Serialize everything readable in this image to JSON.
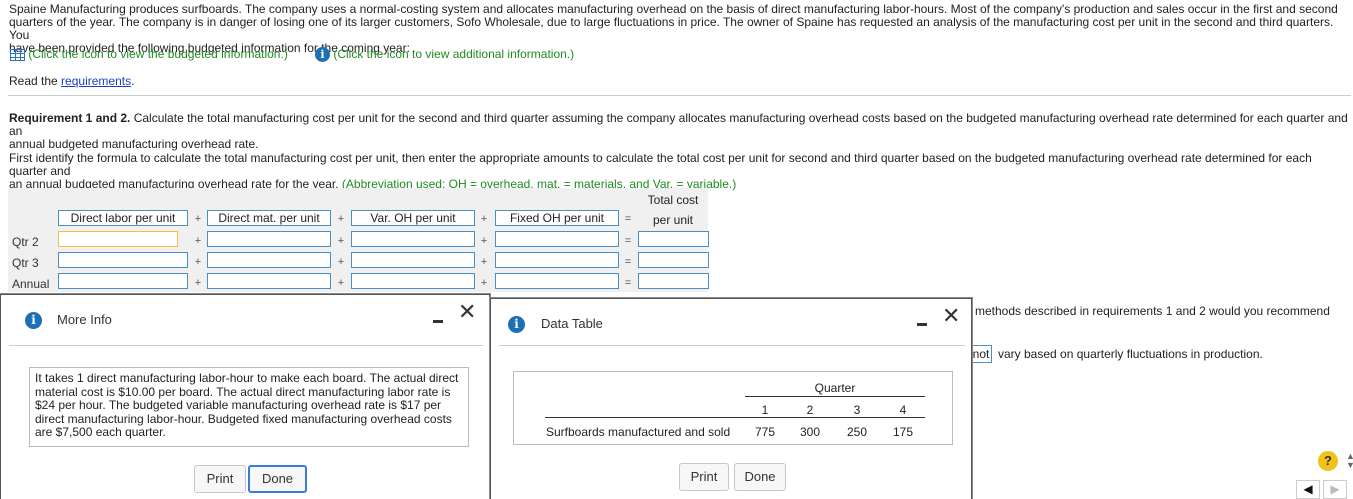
{
  "intro": {
    "line1": "Spaine Manufacturing produces surfboards. The company uses a normal-costing system and allocates manufacturing overhead on the basis of direct manufacturing labor-hours. Most of the company's production and sales occur in the first and second",
    "line2": "quarters of the year. The company is in danger of losing one of its larger customers, Sofo Wholesale, due to large fluctuations in price. The owner of Spaine has requested an analysis of the manufacturing cost per unit in the second and third quarters. You",
    "line3": "have been provided the following budgeted information for the coming year:",
    "budget_link": "(Click the icon to view the budgeted information.)",
    "additional_link": "(Click the icon to view additional information.)",
    "read_prefix": "Read the ",
    "requirements_link": "requirements",
    "read_suffix": "."
  },
  "requirement": {
    "label": "Requirement 1 and 2.",
    "text1": " Calculate the total manufacturing cost per unit for the second and third quarter assuming the company allocates manufacturing overhead costs based on the budgeted manufacturing overhead rate determined for each quarter and an",
    "text2": "annual budgeted manufacturing overhead rate.",
    "instr1": "First identify the formula to calculate the total manufacturing cost per unit, then enter the appropriate amounts to calculate the total cost per unit for second and third quarter based on the budgeted manufacturing overhead rate determined for each quarter and",
    "instr2_plain": "an annual budgeted manufacturing overhead rate for the year. ",
    "instr2_green": "(Abbreviation used: OH = overhead, mat. = materials, and Var. = variable.)"
  },
  "grid": {
    "total_header_top": "Total cost",
    "total_header_bottom": "per unit",
    "headers": [
      "Direct labor per unit",
      "Direct mat. per unit",
      "Var. OH per unit",
      "Fixed OH per unit"
    ],
    "plus": "+",
    "equals": "=",
    "rows": [
      "Qtr 2",
      "Qtr 3",
      "Annual"
    ]
  },
  "behind": {
    "q3_text": "methods described in requirements 1 and 2 would you recommend",
    "dropdown_value": "not",
    "q3_text2": "vary based on quarterly fluctuations in production."
  },
  "more_info": {
    "title": "More Info",
    "icon": "info-icon",
    "body": "It takes 1 direct manufacturing labor-hour to make each board. The actual direct material cost is $10.00 per board. The actual direct manufacturing labor rate is $24 per hour. The budgeted variable manufacturing overhead rate is $17 per direct manufacturing labor-hour. Budgeted fixed manufacturing overhead costs are $7,500 each quarter.",
    "print": "Print",
    "done": "Done"
  },
  "data_table": {
    "title": "Data Table",
    "group_header": "Quarter",
    "quarters": [
      "1",
      "2",
      "3",
      "4"
    ],
    "row_label": "Surfboards manufactured and sold",
    "values": [
      "775",
      "300",
      "250",
      "175"
    ],
    "print": "Print",
    "done": "Done"
  },
  "help": {
    "symbol": "?"
  },
  "nav": {
    "prev": "◀",
    "next": "▶"
  },
  "colors": {
    "accent": "#1f6fb5",
    "link": "#1a3fc4",
    "green": "#1f8b1f"
  }
}
